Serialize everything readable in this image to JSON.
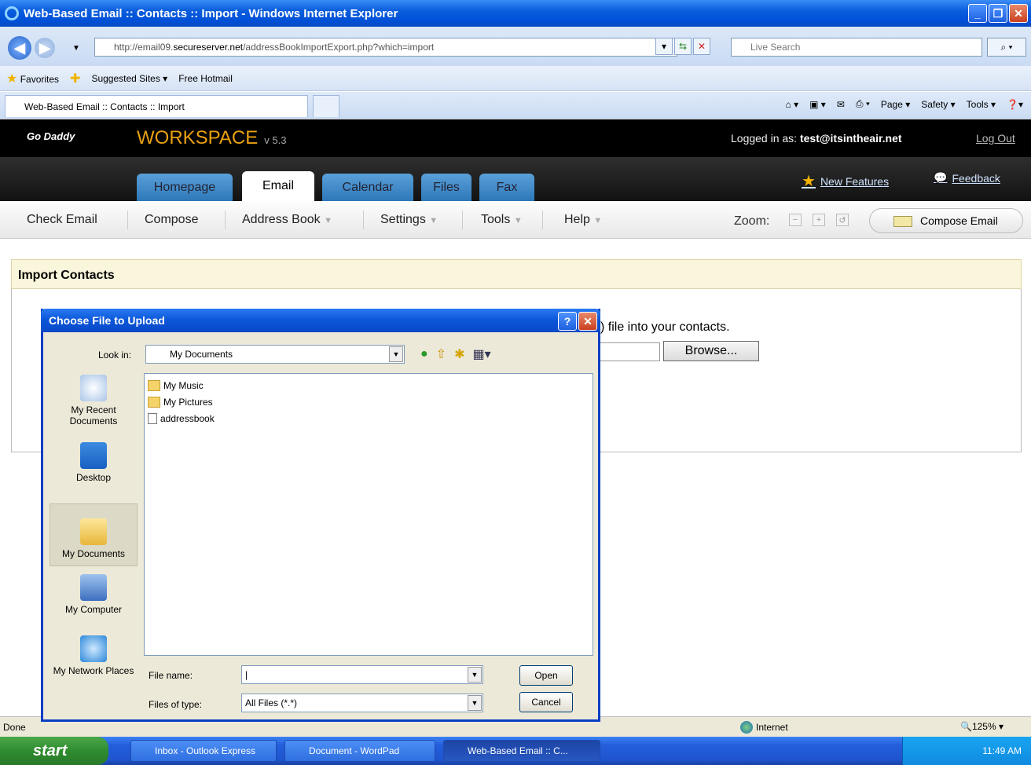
{
  "window": {
    "title": "Web-Based Email :: Contacts :: Import - Windows Internet Explorer",
    "address": "http://email09.securesever.net/addressBookImportExport.php?which=import",
    "address_prefix": "http://email09.",
    "address_host": "secureserver.net",
    "address_path": "/addressBookImportExport.php?which=import",
    "search_placeholder": "Live Search"
  },
  "favorites": {
    "label": "Favorites",
    "items": [
      "Suggested Sites ▾",
      "Free Hotmail"
    ]
  },
  "tab": {
    "title": "Web-Based Email :: Contacts :: Import",
    "commands": [
      "Page ▾",
      "Safety ▾",
      "Tools ▾"
    ]
  },
  "workspace": {
    "brand": "Go Daddy",
    "product": "WORKSPACE",
    "version": "v 5.3",
    "logged_in_label": "Logged in as:",
    "user": "test@itsintheair.net",
    "logout": "Log Out",
    "tabs": [
      "Homepage",
      "Email",
      "Calendar",
      "Files",
      "Fax"
    ],
    "new_features": "New Features",
    "feedback": "Feedback",
    "submenu": [
      "Check Email",
      "Compose",
      "Address Book",
      "Settings",
      "Tools",
      "Help"
    ],
    "zoom_label": "Zoom:",
    "compose_email": "Compose Email"
  },
  "content": {
    "section_title": "Import Contacts",
    "instruction_tail": ") file into your contacts.",
    "browse": "Browse..."
  },
  "dialog": {
    "title": "Choose File to Upload",
    "look_in_label": "Look in:",
    "look_in_value": "My Documents",
    "places": [
      "My Recent Documents",
      "Desktop",
      "My Documents",
      "My Computer",
      "My Network Places"
    ],
    "files": [
      "My Music",
      "My Pictures",
      "addressbook"
    ],
    "file_name_label": "File name:",
    "file_name_value": "",
    "files_of_type_label": "Files of type:",
    "files_of_type_value": "All Files (*.*)",
    "open": "Open",
    "cancel": "Cancel"
  },
  "status": {
    "text": "Done",
    "zone": "Internet",
    "zoom": "125%"
  },
  "taskbar": {
    "start": "start",
    "items": [
      "Inbox - Outlook Express",
      "Document - WordPad",
      "Web-Based Email :: C..."
    ],
    "time": "11:49 AM"
  }
}
